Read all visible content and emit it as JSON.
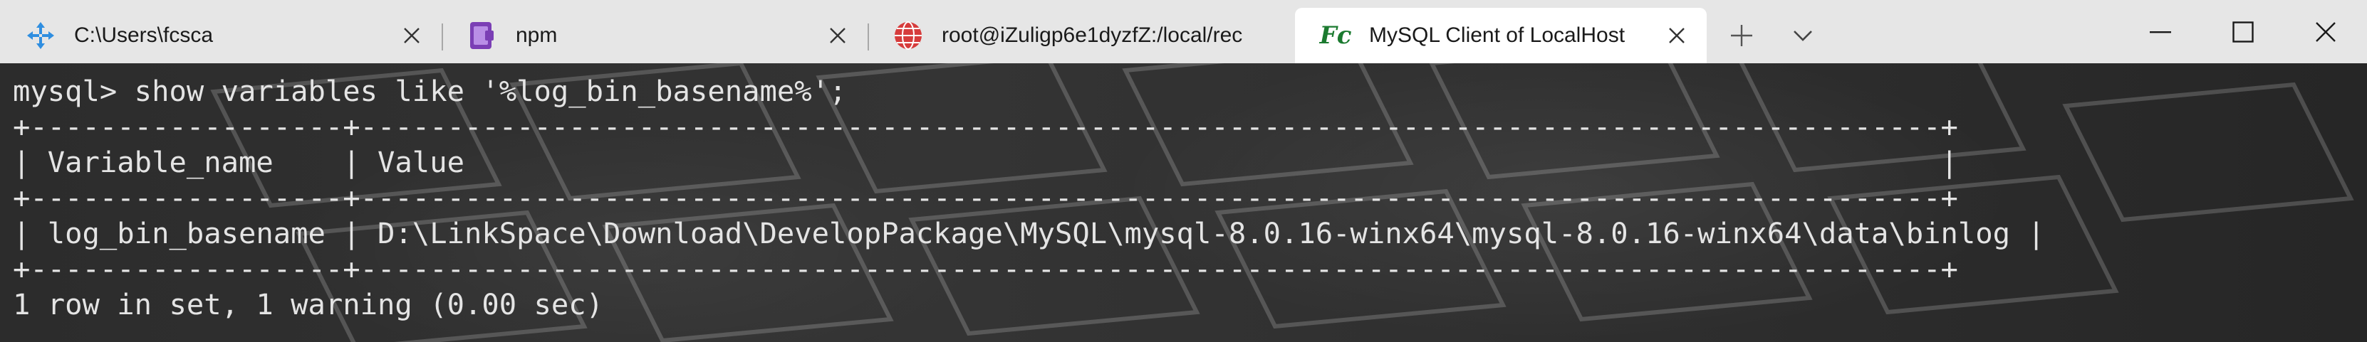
{
  "tabs": [
    {
      "title": "C:\\Users\\fcsca",
      "icon": "azure-cloud-shell-icon",
      "active": false
    },
    {
      "title": "npm",
      "icon": "powershell-purple-icon",
      "active": false
    },
    {
      "title": "root@iZuligp6e1dyzfZ:/local/rec",
      "icon": "ubuntu-globe-icon",
      "active": false
    },
    {
      "title": "MySQL Client of LocalHost",
      "icon": "fc-icon",
      "icon_text": "Fc",
      "active": true
    }
  ],
  "tab_actions": {
    "new_tab": "new-tab-plus-icon",
    "dropdown": "chevron-down-icon"
  },
  "window_controls": {
    "minimize": "minimize-icon",
    "maximize": "maximize-icon",
    "close": "close-icon"
  },
  "terminal": {
    "lines": [
      "mysql> show variables like '%log_bin_basename%';",
      "+------------------+-------------------------------------------------------------------------------------------+",
      "| Variable_name    | Value                                                                                     |",
      "+------------------+-------------------------------------------------------------------------------------------+",
      "| log_bin_basename | D:\\LinkSpace\\Download\\DevelopPackage\\MySQL\\mysql-8.0.16-winx64\\mysql-8.0.16-winx64\\data\\binlog |",
      "+------------------+-------------------------------------------------------------------------------------------+",
      "1 row in set, 1 warning (0.00 sec)"
    ]
  },
  "colors": {
    "tabbar_bg": "#e6e6e6",
    "active_tab_bg": "#ffffff",
    "terminal_bg": "#2e2e2e",
    "terminal_fg": "#e4e4e4",
    "fc_icon_green": "#1b7a2f"
  }
}
